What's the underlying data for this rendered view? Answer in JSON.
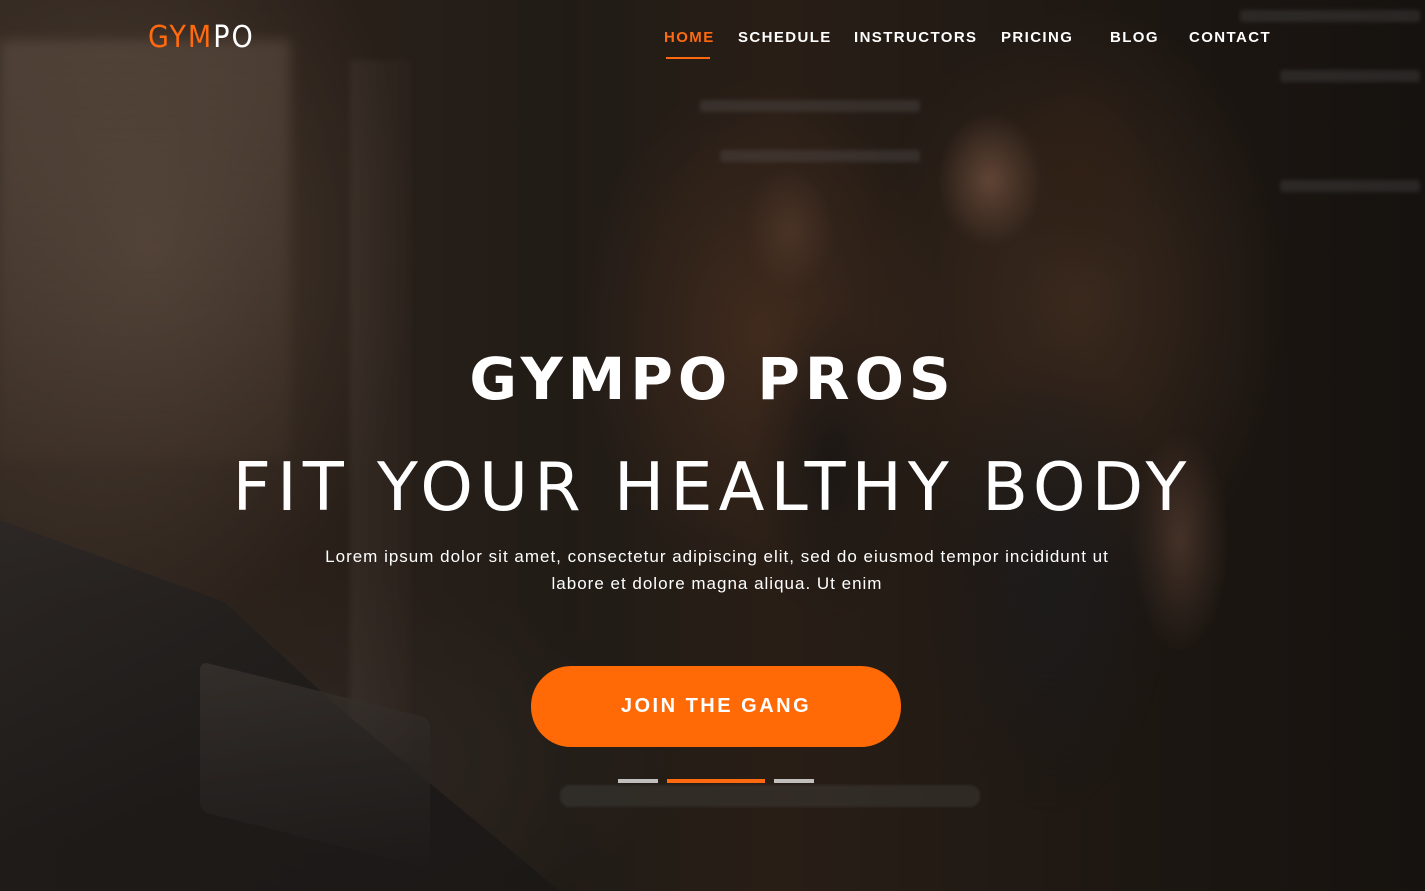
{
  "brand": {
    "logo_part1": "GYM",
    "logo_part2": "PO",
    "accent_color": "#ff6a10"
  },
  "nav": {
    "items": [
      {
        "label": "HOME",
        "active": true
      },
      {
        "label": "SCHEDULE",
        "active": false
      },
      {
        "label": "INSTRUCTORS",
        "active": false
      },
      {
        "label": "PRICING",
        "active": false
      },
      {
        "label": "BLOG",
        "active": false
      },
      {
        "label": "CONTACT",
        "active": false
      }
    ]
  },
  "hero": {
    "title": "GYMPO PROS",
    "subtitle": "FIT YOUR HEALTHY BODY",
    "description": "Lorem ipsum dolor sit amet, consectetur adipiscing elit, sed do eiusmod tempor incididunt ut labore et dolore magna aliqua. Ut enim",
    "cta_label": "JOIN THE GANG",
    "cta_color": "#ff6a06"
  },
  "slider": {
    "slide_count": 3,
    "active_index": 1
  }
}
